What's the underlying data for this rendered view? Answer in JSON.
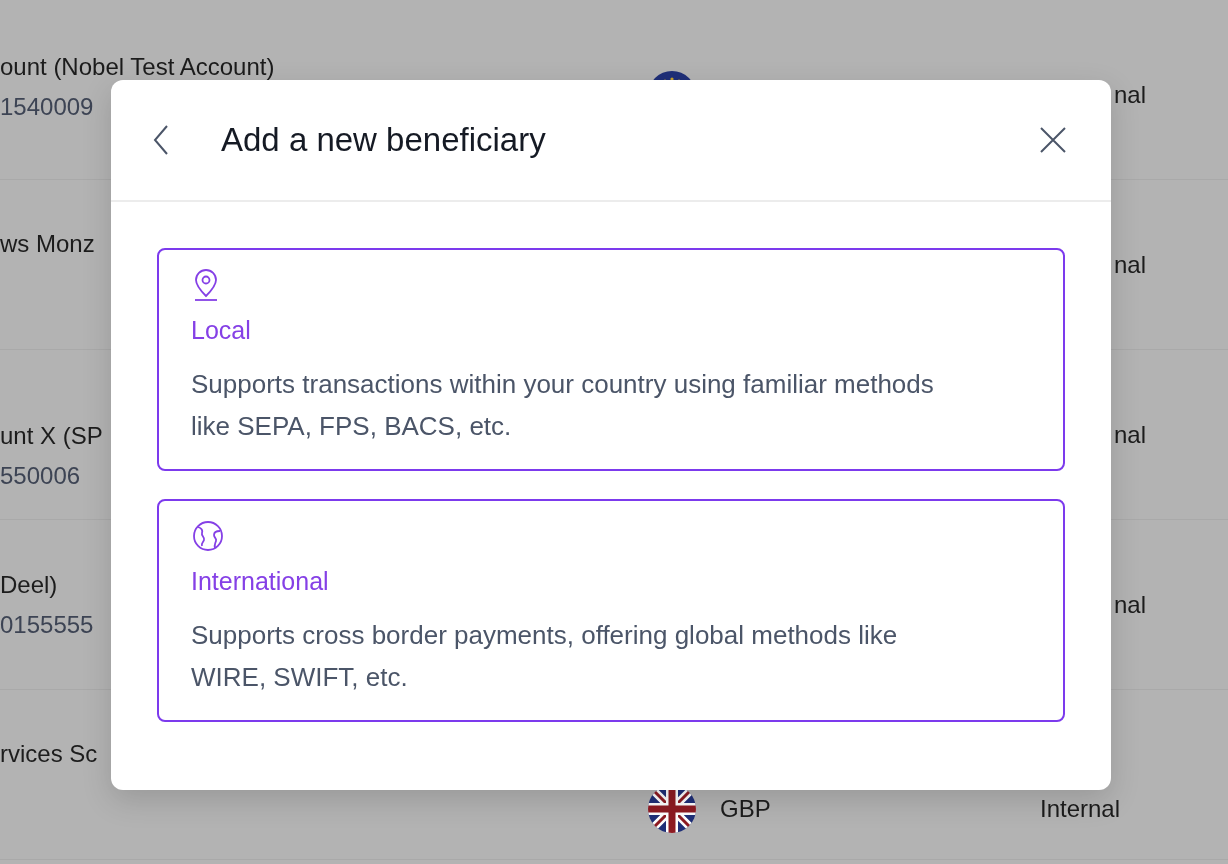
{
  "background_rows": [
    {
      "name": "ount (Nobel Test Account)",
      "number": "1540009",
      "kind": "eu",
      "type": "nal"
    },
    {
      "name": "ws Monz",
      "type": "nal"
    },
    {
      "name": "unt X (SP",
      "number": "550006",
      "type": "nal"
    },
    {
      "name": "Deel)",
      "number": "0155555",
      "type": "nal"
    },
    {
      "name": "rvices Sc",
      "kind": "gb",
      "currency": "GBP",
      "type": "Internal"
    }
  ],
  "dialog": {
    "title": "Add a new beneficiary",
    "options": [
      {
        "kind": "local",
        "title": "Local",
        "description": "Supports transactions within your country using familiar methods like SEPA, FPS, BACS, etc."
      },
      {
        "kind": "international",
        "title": "International",
        "description": "Supports cross border payments, offering global methods like WIRE, SWIFT, etc."
      }
    ]
  }
}
